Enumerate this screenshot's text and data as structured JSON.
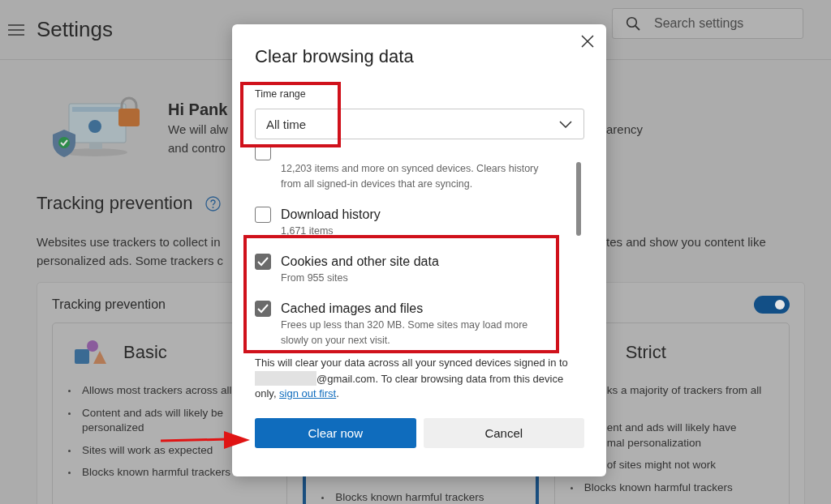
{
  "header": {
    "title": "Settings",
    "search": {
      "placeholder": "Search settings"
    }
  },
  "greeting": {
    "title": "Hi Pank",
    "lines": [
      "We will alw",
      "and contro"
    ],
    "right_fragment": "arency"
  },
  "tracking": {
    "heading": "Tracking prevention",
    "description_left": [
      "Websites use trackers to collect in",
      "personalized ads. Some trackers c"
    ],
    "description_right": "tes and show you content like",
    "card": {
      "title": "Tracking prevention",
      "on": true,
      "levels": [
        {
          "title": "Basic",
          "selected": false,
          "bullets": [
            {
              "text": "Allows most trackers across all",
              "cut": false
            },
            {
              "text": "Content and ads will likely be personalized",
              "cut": false
            },
            {
              "text": "Sites will work as expected",
              "cut": false
            },
            {
              "text": "Blocks known harmful trackers",
              "cut": false
            }
          ]
        },
        {
          "selected": true,
          "bullets": [
            {
              "text": "Blocks known harmful trackers",
              "cut": false
            }
          ]
        },
        {
          "title": "Strict",
          "selected": false,
          "bullets": [
            {
              "text": "ks a majority of trackers from all",
              "cut": true
            },
            {
              "text": "ent and ads will likely have\nmal personalization",
              "cut": true
            },
            {
              "text": "of sites might not work",
              "cut": true
            },
            {
              "text": "Blocks known harmful trackers",
              "cut": false
            }
          ]
        }
      ]
    }
  },
  "dialog": {
    "title": "Clear browsing data",
    "time_range": {
      "label": "Time range",
      "value": "All time"
    },
    "items": [
      {
        "description": "12,203 items and more on synced devices. Clears history from all signed-in devices that are syncing.",
        "checked": false
      },
      {
        "title": "Download history",
        "description": "1,671 items",
        "checked": false
      },
      {
        "title": "Cookies and other site data",
        "description": "From 955 sites",
        "checked": true
      },
      {
        "title": "Cached images and files",
        "description": "Frees up less than 320 MB. Some sites may load more slowly on your next visit.",
        "checked": true
      }
    ],
    "notice": {
      "before": "This will clear your data across all your synced devices signed in to",
      "after": "@gmail.com. To clear browsing data from this device only,",
      "link": "sign out first",
      "end": "."
    },
    "buttons": [
      {
        "label": "Clear now",
        "kind": "primary"
      },
      {
        "label": "Cancel",
        "kind": "secondary"
      }
    ]
  },
  "annotations": [
    {
      "kind": "frame"
    },
    {
      "kind": "frame"
    },
    {
      "kind": "arrow"
    }
  ]
}
